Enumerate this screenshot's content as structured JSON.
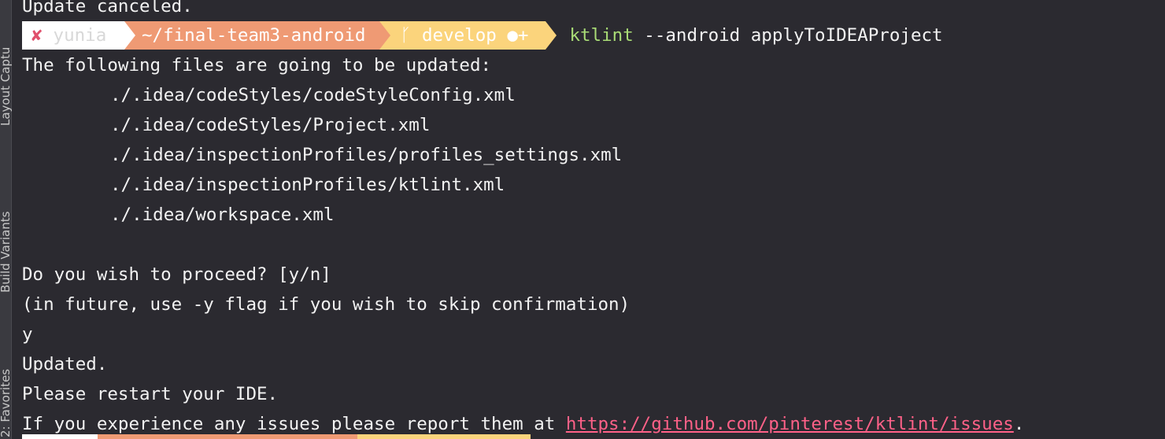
{
  "sidebar": {
    "tabs": [
      {
        "label": "Layout Captu"
      },
      {
        "label": "Build Variants"
      },
      {
        "label": "2: Favorites"
      }
    ]
  },
  "terminal": {
    "line_top": "Update canceled.",
    "prompt": {
      "status_symbol": "✘",
      "user": "yunia",
      "path": "~/final-team3-android",
      "branch_icon": "ᚴ",
      "branch": "develop ●+",
      "command": "ktlint",
      "args": " --android applyToIDEAProject"
    },
    "intro": "The following files are going to be updated:",
    "files": [
      "./.idea/codeStyles/codeStyleConfig.xml",
      "./.idea/codeStyles/Project.xml",
      "./.idea/inspectionProfiles/profiles_settings.xml",
      "./.idea/inspectionProfiles/ktlint.xml",
      "./.idea/workspace.xml"
    ],
    "question": "Do you wish to proceed? [y/n]",
    "hint": "(in future, use -y flag if you wish to skip confirmation)",
    "answer": "y",
    "updated": "Updated.",
    "restart": "Please restart your IDE.",
    "issues_prefix": "If you experience any issues please report them at ",
    "issues_link": "https://github.com/pinterest/ktlint/issues",
    "issues_suffix": "."
  },
  "colors": {
    "background": "#2b2a30",
    "segment_status": "#ffffff",
    "segment_path": "#ef9a74",
    "segment_git": "#fbd47c",
    "command": "#a9dc76",
    "link": "#ff6188"
  }
}
